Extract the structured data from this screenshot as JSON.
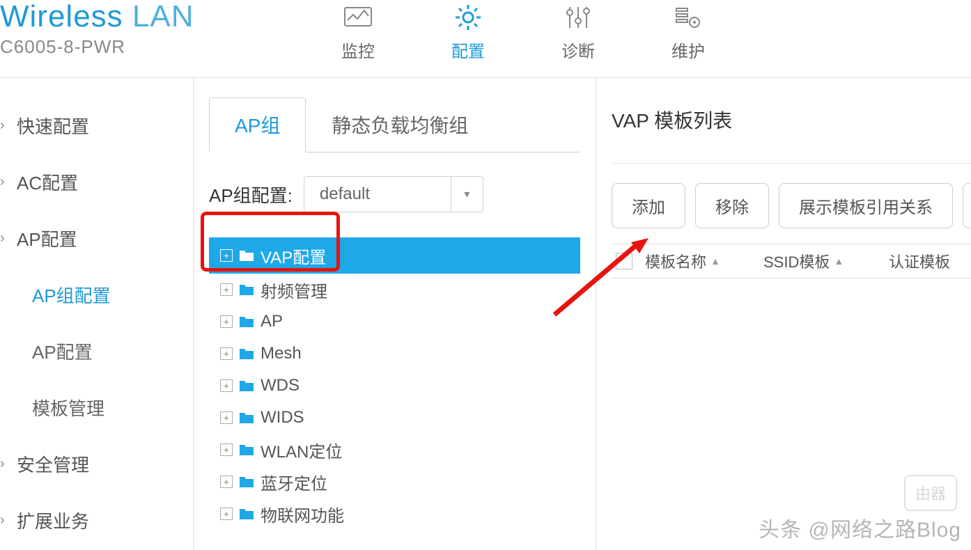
{
  "brand": {
    "title_a": "Wireless",
    "title_b": "LAN",
    "model": "C6005-8-PWR"
  },
  "topnav": {
    "items": [
      {
        "label": "监控"
      },
      {
        "label": "配置"
      },
      {
        "label": "诊断"
      },
      {
        "label": "维护"
      }
    ]
  },
  "sidebar": {
    "groups": [
      {
        "label": "快速配置"
      },
      {
        "label": "AC配置"
      },
      {
        "label": "AP配置"
      }
    ],
    "subs": [
      {
        "label": "AP组配置"
      },
      {
        "label": "AP配置"
      },
      {
        "label": "模板管理"
      }
    ],
    "groups2": [
      {
        "label": "安全管理"
      },
      {
        "label": "扩展业务"
      }
    ]
  },
  "mid": {
    "tabs": [
      {
        "label": "AP组"
      },
      {
        "label": "静态负载均衡组"
      }
    ],
    "config_label": "AP组配置:",
    "select_value": "default",
    "tree": [
      {
        "label": "VAP配置"
      },
      {
        "label": "射频管理"
      },
      {
        "label": "AP"
      },
      {
        "label": "Mesh"
      },
      {
        "label": "WDS"
      },
      {
        "label": "WIDS"
      },
      {
        "label": "WLAN定位"
      },
      {
        "label": "蓝牙定位"
      },
      {
        "label": "物联网功能"
      }
    ]
  },
  "right": {
    "title": "VAP 模板列表",
    "buttons": {
      "add": "添加",
      "remove": "移除",
      "show": "展示模板引用关系"
    },
    "columns": [
      {
        "label": "模板名称"
      },
      {
        "label": "SSID模板"
      },
      {
        "label": "认证模板"
      }
    ]
  },
  "watermark": {
    "text": "头条 @网络之路Blog",
    "badge": "由器"
  }
}
